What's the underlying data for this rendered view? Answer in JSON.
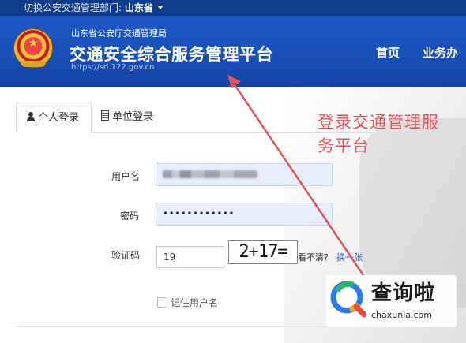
{
  "topbar": {
    "label": "切换公安交通管理部门:",
    "province": "山东省"
  },
  "header": {
    "org": "山东省公安厅交通管理局",
    "title": "交通安全综合服务管理平台",
    "url": "https://sd.122.gov.cn",
    "nav": [
      "首页",
      "业务办"
    ]
  },
  "tabs": [
    {
      "label": "个人登录",
      "icon": "user-icon",
      "active": true
    },
    {
      "label": "单位登录",
      "icon": "building-icon",
      "active": false
    }
  ],
  "form": {
    "username_label": "用户名",
    "password_label": "密码",
    "password_value": "••••••••••••",
    "captcha_label": "验证码",
    "captcha_value": "19",
    "captcha_image_text": "2+17=",
    "captcha_hint": "看不清?",
    "captcha_refresh": "换一张",
    "remember_label": "记住用户名"
  },
  "annotation": {
    "line1": "登录交通管理服",
    "line2": "务平台",
    "color": "#e0555c"
  },
  "watermark": {
    "text": "查询啦",
    "url": "chaxunla.com"
  },
  "colors": {
    "header_blue": "#1a4fb8",
    "topbar": "#0e3c8c",
    "link": "#1f5fc6"
  }
}
